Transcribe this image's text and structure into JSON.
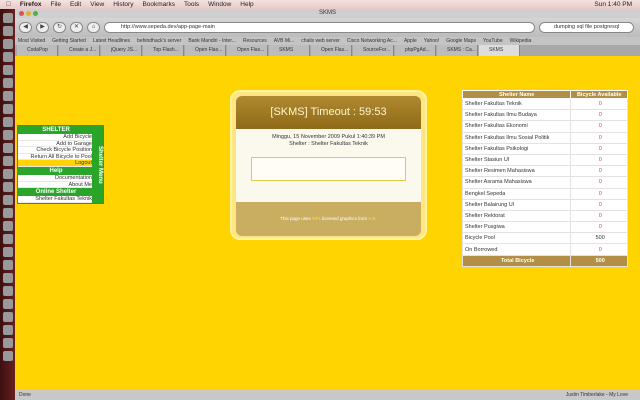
{
  "menubar": {
    "items": [
      "Firefox",
      "File",
      "Edit",
      "View",
      "History",
      "Bookmarks",
      "Tools",
      "Window",
      "Help"
    ],
    "clock": "Sun 1:40 PM"
  },
  "window": {
    "title": "SKMS"
  },
  "toolbar": {
    "url": "http://www.sepeda.dev/app-page-main",
    "search": "dumping sql file postgresql"
  },
  "bookmarks": [
    "Most Visited",
    "Getting Started",
    "Latest Headlines",
    "behindhack's server",
    "Bank Mandiri - Inter...",
    "Resources",
    "AVB Mi...",
    "chalis web server",
    "Cisco Networking Ac...",
    "Apple",
    "Yahoo!",
    "Google Maps",
    "YouTube",
    "Wikipedia"
  ],
  "tabs": [
    "CodaPop",
    "Create a J...",
    "jQuery JS...",
    "Top Flash...",
    "Open Flas...",
    "Open Flas...",
    "SKMS",
    "Open Flas...",
    "SourceFor...",
    "phpPgAd...",
    "SKMS : Ca...",
    "SKMS"
  ],
  "sidebar": {
    "shelter_header": "SHELTER",
    "items": [
      "Add Bicycle",
      "Add to Garage",
      "Check Bicycle Position",
      "Return All Bicycle to Pool",
      "Logout"
    ],
    "help_header": "Help",
    "help_items": [
      "Documentation",
      "About Me"
    ],
    "online_header": "Online Shelter",
    "online_items": [
      "Shelter Fakultas Teknik"
    ],
    "vertical_label": "Shelter Menu"
  },
  "dialog": {
    "title": "[SKMS] Timeout : 59:53",
    "datetime": "Minggu, 15 November 2009 Pukul 1:40:39 PM",
    "shelter": "Shelter : Shelter Fakultas Teknik",
    "footer_pre": "This page uses ",
    "footer_link1": "GPL",
    "footer_mid": " licensed graphics from ",
    "footer_link2": "A.E."
  },
  "table": {
    "headers": [
      "Shelter Name",
      "Bicycle Available"
    ],
    "rows": [
      [
        "Shelter Fakultas Teknik",
        "0"
      ],
      [
        "Shelter Fakultas Ilmu Budaya",
        "0"
      ],
      [
        "Shelter Fakultas Ekonomi",
        "0"
      ],
      [
        "Shelter Fakultas Ilmu Sosial Politik",
        "0"
      ],
      [
        "Shelter Fakultas Psikologi",
        "0"
      ],
      [
        "Shelter Stasiun UI",
        "0"
      ],
      [
        "Shelter Resimen Mahasiswa",
        "0"
      ],
      [
        "Shelter Asrama Mahasiswa",
        "0"
      ],
      [
        "Bengkel Sepeda",
        "0"
      ],
      [
        "Shelter Balairung UI",
        "0"
      ],
      [
        "Shelter Rektorat",
        "0"
      ],
      [
        "Shelter Pusgiwa",
        "0"
      ],
      [
        "Bicycle Pool",
        "500"
      ],
      [
        "On Borrowed",
        "0"
      ]
    ],
    "total_label": "Total Bicycle",
    "total_value": "500"
  },
  "status": {
    "left": "Done",
    "right": "Justin Timberlake - My Love"
  }
}
